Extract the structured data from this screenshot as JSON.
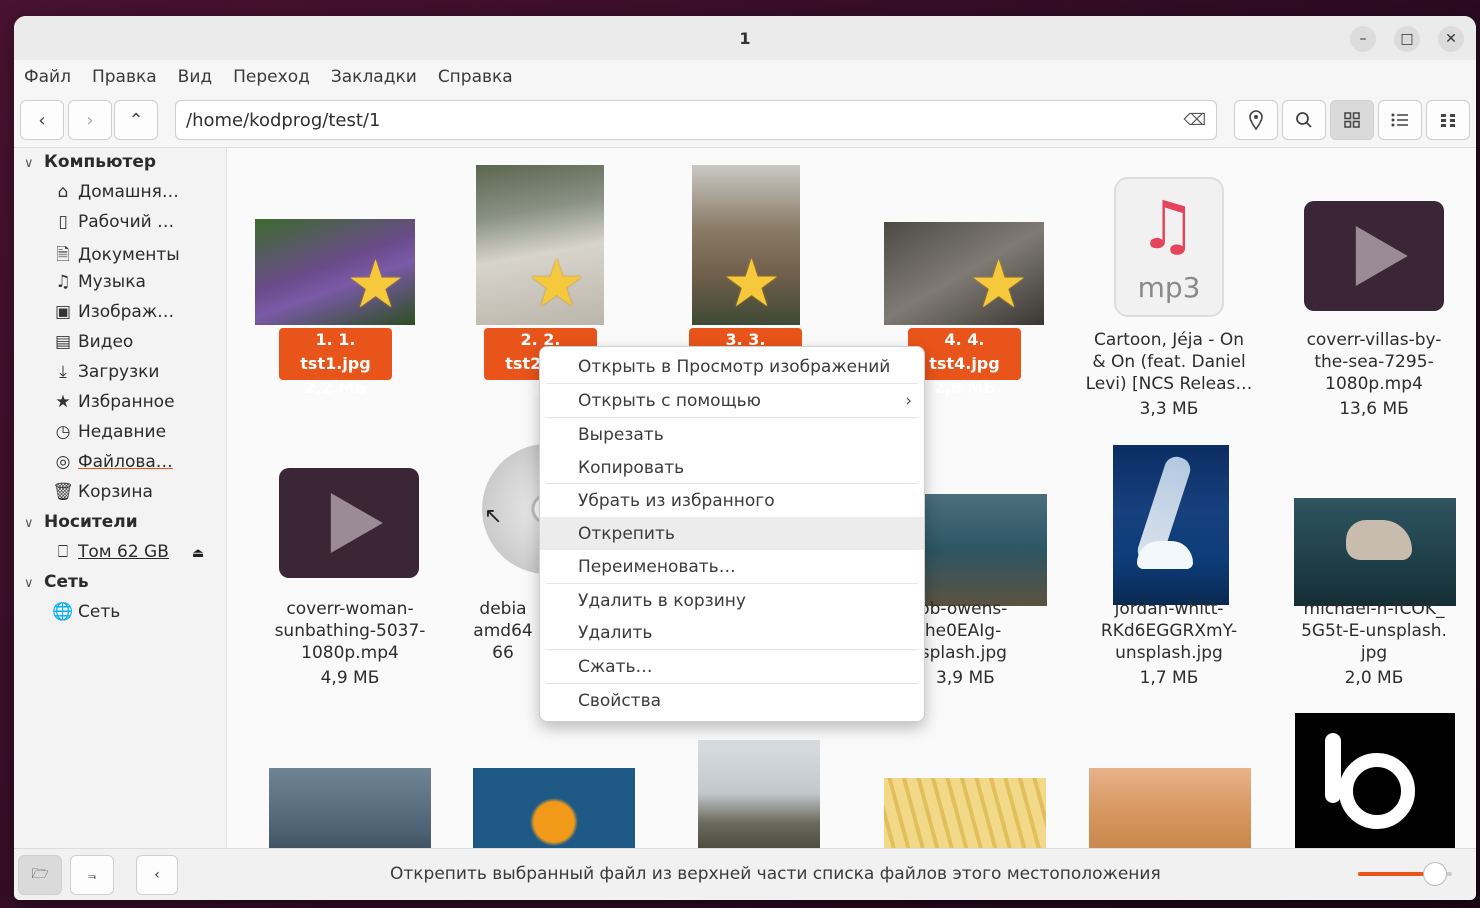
{
  "window": {
    "title": "1"
  },
  "window_controls": {
    "minimize": "–",
    "maximize": "□",
    "close": "✕"
  },
  "menu": [
    "Файл",
    "Правка",
    "Вид",
    "Переход",
    "Закладки",
    "Справка"
  ],
  "path": {
    "value": "/home/kodprog/test/1"
  },
  "sidebar": {
    "computer_label": "Компьютер",
    "items": [
      {
        "icon": "home-icon",
        "label": "Домашня…"
      },
      {
        "icon": "desktop-icon",
        "label": "Рабочий …"
      },
      {
        "icon": "document-icon",
        "label": "Документы"
      },
      {
        "icon": "music-icon",
        "label": "Музыка"
      },
      {
        "icon": "image-icon",
        "label": "Изображ…"
      },
      {
        "icon": "video-icon",
        "label": "Видео"
      },
      {
        "icon": "download-icon",
        "label": "Загрузки"
      },
      {
        "icon": "star-icon",
        "label": "Избранное"
      },
      {
        "icon": "clock-icon",
        "label": "Недавние"
      },
      {
        "icon": "filesystem-icon",
        "label": "Файлова…"
      },
      {
        "icon": "trash-icon",
        "label": "Корзина"
      }
    ],
    "media_label": "Носители",
    "media_item": "Том 62 GB",
    "network_label": "Сеть",
    "network_item": "Сеть"
  },
  "files": {
    "f1": {
      "name": "1. 1. tst1.jpg",
      "size": "2,2 МБ"
    },
    "f2": {
      "name": "2. 2. tst2.jpg",
      "size": "1,"
    },
    "f3": {
      "name": "3. 3. tst3.jpg"
    },
    "f4": {
      "name": "4. 4. tst4.jpg",
      "size": "2,8 МБ"
    },
    "f5": {
      "name1": "Cartoon, Jéja - On",
      "name2": "& On (feat. Daniel",
      "name3": "Levi) [NCS Releas…",
      "size": "3,3 МБ",
      "icon_text": "mp3"
    },
    "f6": {
      "name1": "coverr-villas-by-",
      "name2": "the-sea-7295-",
      "name3": "1080p.mp4",
      "size": "13,6 МБ"
    },
    "f7": {
      "name1": "coverr-woman-",
      "name2": "sunbathing-5037-",
      "name3": "1080p.mp4",
      "size": "4,9 МБ"
    },
    "f8": {
      "name1": "debia",
      "name2": "amd64",
      "name3": "66"
    },
    "f9": {
      "name1": "kob-owens-",
      "name2": "Jkhe0EAIg-",
      "name3": "nsplash.jpg",
      "size": "3,9 МБ"
    },
    "f10": {
      "name1": "jordan-whitt-",
      "name2": "RKd6EGGRXmY-",
      "name3": "unsplash.jpg",
      "size": "1,7 МБ"
    },
    "f11": {
      "name1": "michael-h-fCOK_",
      "name2": "5G5t-E-unsplash.",
      "name3": "jpg",
      "size": "2,0 МБ"
    }
  },
  "context_menu": [
    "Открыть в Просмотр изображений",
    "Открыть с помощью",
    "Вырезать",
    "Копировать",
    "Убрать из избранного",
    "Открепить",
    "Переименовать…",
    "Удалить в корзину",
    "Удалить",
    "Сжать…",
    "Свойства"
  ],
  "statusbar": {
    "text": "Открепить выбранный файл из верхней части списка файлов этого местоположения",
    "zoom_fraction": 0.82
  },
  "colors": {
    "accent": "#e9541a",
    "star": "#f6c83b"
  }
}
